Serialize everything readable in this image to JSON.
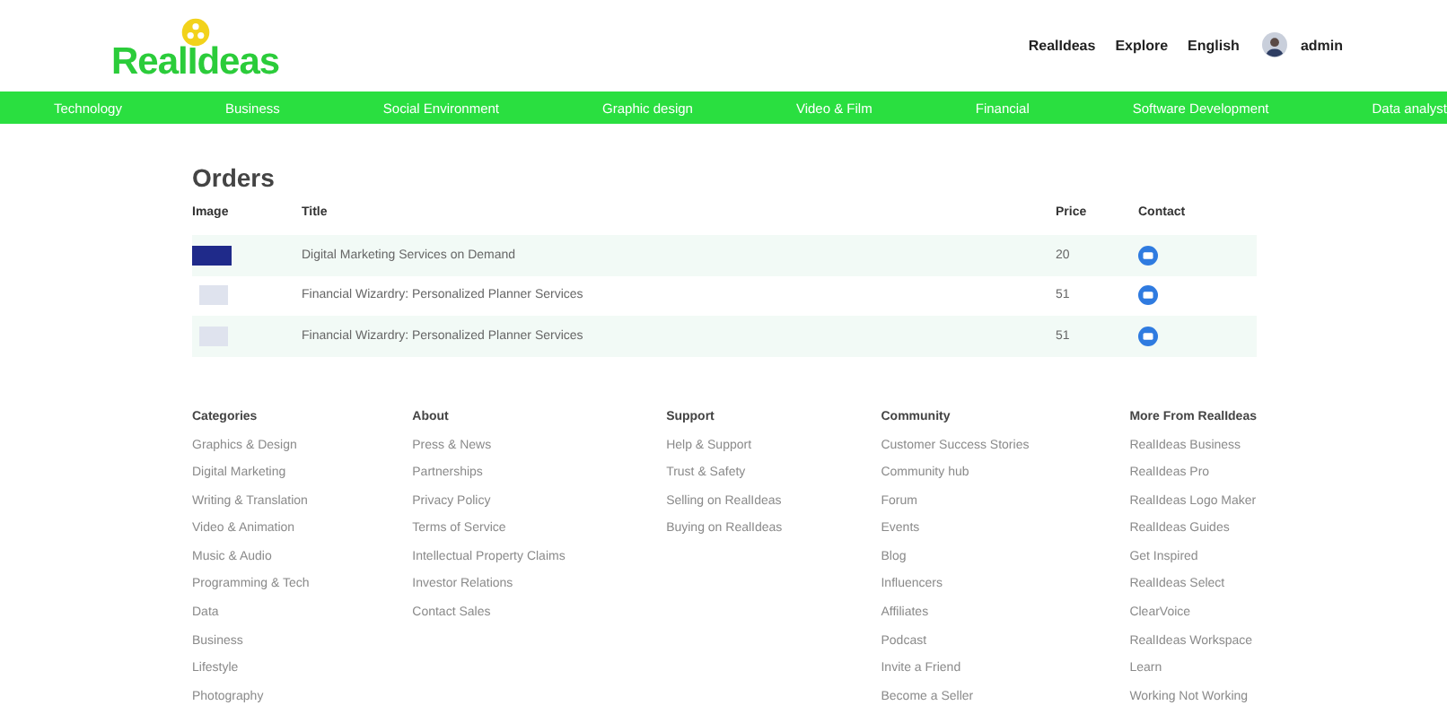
{
  "header": {
    "logo": "RealIdeas",
    "links": [
      "RealIdeas",
      "Explore",
      "English"
    ],
    "user": "admin"
  },
  "nav": [
    "Technology",
    "Business",
    "Social Environment",
    "Graphic design",
    "Video & Film",
    "Financial",
    "Software Development",
    "Data analyst"
  ],
  "orders": {
    "title": "Orders",
    "columns": [
      "Image",
      "Title",
      "Price",
      "Contact"
    ],
    "rows": [
      {
        "kind": "dark",
        "title": "Digital Marketing Services on Demand",
        "price": "20"
      },
      {
        "kind": "light",
        "title": "Financial Wizardry: Personalized Planner Services",
        "price": "51"
      },
      {
        "kind": "light",
        "title": "Financial Wizardry: Personalized Planner Services",
        "price": "51"
      }
    ]
  },
  "footer": [
    {
      "heading": "Categories",
      "links": [
        "Graphics & Design",
        "Digital Marketing",
        "Writing & Translation",
        "Video & Animation",
        "Music & Audio",
        "Programming & Tech",
        "Data",
        "Business",
        "Lifestyle",
        "Photography"
      ]
    },
    {
      "heading": "About",
      "links": [
        "Press & News",
        "Partnerships",
        "Privacy Policy",
        "Terms of Service",
        "Intellectual Property Claims",
        "Investor Relations",
        "Contact Sales"
      ]
    },
    {
      "heading": "Support",
      "links": [
        "Help & Support",
        "Trust & Safety",
        "Selling on RealIdeas",
        "Buying on RealIdeas"
      ]
    },
    {
      "heading": "Community",
      "links": [
        "Customer Success Stories",
        "Community hub",
        "Forum",
        "Events",
        "Blog",
        "Influencers",
        "Affiliates",
        "Podcast",
        "Invite a Friend",
        "Become a Seller"
      ]
    },
    {
      "heading": "More From RealIdeas",
      "links": [
        "RealIdeas Business",
        "RealIdeas Pro",
        "RealIdeas Logo Maker",
        "RealIdeas Guides",
        "Get Inspired",
        "RealIdeas Select",
        "ClearVoice",
        "RealIdeas Workspace",
        "Learn",
        "Working Not Working"
      ]
    }
  ]
}
